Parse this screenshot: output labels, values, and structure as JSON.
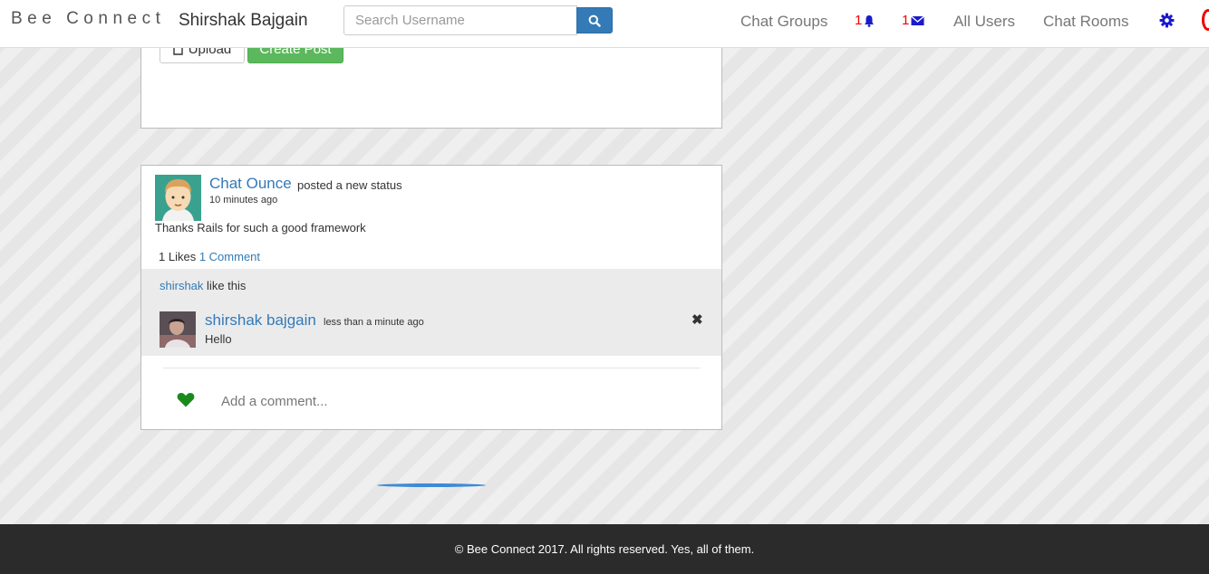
{
  "navbar": {
    "brand": "Bee Connect",
    "user_name": "Shirshak Bajgain",
    "search_placeholder": "Search Username",
    "chat_groups": "Chat Groups",
    "notifications_count": "1",
    "messages_count": "1",
    "all_users": "All Users",
    "chat_rooms": "Chat Rooms",
    "icons": {
      "search": "search-icon",
      "notifications": "bell-icon",
      "messages": "envelope-icon",
      "settings": "gear-icon"
    }
  },
  "composer": {
    "upload_label": "Upload",
    "create_label": "Create Post"
  },
  "post": {
    "author": "Chat Ounce",
    "verb": "posted a new status",
    "time": "10 minutes ago",
    "body": "Thanks Rails for such a good framework",
    "likes_label": "1 Likes",
    "comments_label": "1 Comment",
    "liked_by_user": "shirshak",
    "liked_by_suffix": "like this",
    "comment": {
      "author": "shirshak bajgain",
      "time": "less than a minute ago",
      "text": "Hello",
      "delete_symbol": "✖"
    },
    "add_comment_placeholder": "Add a comment..."
  },
  "footer": {
    "text": "© Bee Connect 2017. All rights reserved. Yes, all of them."
  },
  "colors": {
    "accent": "#337ab7",
    "success": "#5cb85c",
    "badge": "#ee0000",
    "heart": "#1a8a1a",
    "footer_bg": "#2b2b2b"
  }
}
